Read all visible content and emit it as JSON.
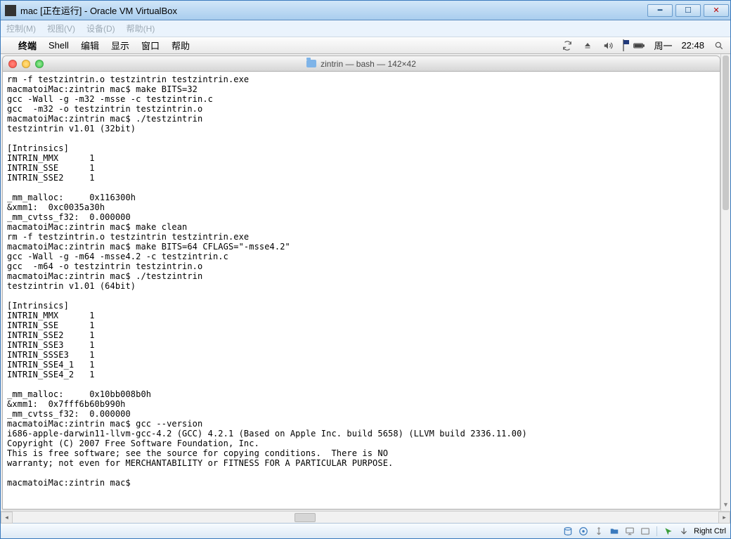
{
  "vbox": {
    "title": "mac [正在运行] - Oracle VM VirtualBox",
    "menu": [
      "控制(M)",
      "视图(V)",
      "设备(D)",
      "帮助(H)"
    ],
    "status_hostkey": "Right Ctrl"
  },
  "mac_menubar": {
    "left": [
      "终端",
      "Shell",
      "编辑",
      "显示",
      "窗口",
      "帮助"
    ],
    "right_day": "周一",
    "right_time": "22:48"
  },
  "terminal": {
    "title": "zintrin — bash — 142×42",
    "lines": [
      "rm -f testzintrin.o testzintrin testzintrin.exe",
      "macmatoiMac:zintrin mac$ make BITS=32",
      "gcc -Wall -g -m32 -msse -c testzintrin.c",
      "gcc  -m32 -o testzintrin testzintrin.o",
      "macmatoiMac:zintrin mac$ ./testzintrin",
      "testzintrin v1.01 (32bit)",
      "",
      "[Intrinsics]",
      "INTRIN_MMX      1",
      "INTRIN_SSE      1",
      "INTRIN_SSE2     1",
      "",
      "_mm_malloc:     0x116300h",
      "&xmm1:  0xc0035a30h",
      "_mm_cvtss_f32:  0.000000",
      "macmatoiMac:zintrin mac$ make clean",
      "rm -f testzintrin.o testzintrin testzintrin.exe",
      "macmatoiMac:zintrin mac$ make BITS=64 CFLAGS=\"-msse4.2\"",
      "gcc -Wall -g -m64 -msse4.2 -c testzintrin.c",
      "gcc  -m64 -o testzintrin testzintrin.o",
      "macmatoiMac:zintrin mac$ ./testzintrin",
      "testzintrin v1.01 (64bit)",
      "",
      "[Intrinsics]",
      "INTRIN_MMX      1",
      "INTRIN_SSE      1",
      "INTRIN_SSE2     1",
      "INTRIN_SSE3     1",
      "INTRIN_SSSE3    1",
      "INTRIN_SSE4_1   1",
      "INTRIN_SSE4_2   1",
      "",
      "_mm_malloc:     0x10bb008b0h",
      "&xmm1:  0x7fff6b60b990h",
      "_mm_cvtss_f32:  0.000000",
      "macmatoiMac:zintrin mac$ gcc --version",
      "i686-apple-darwin11-llvm-gcc-4.2 (GCC) 4.2.1 (Based on Apple Inc. build 5658) (LLVM build 2336.11.00)",
      "Copyright (C) 2007 Free Software Foundation, Inc.",
      "This is free software; see the source for copying conditions.  There is NO",
      "warranty; not even for MERCHANTABILITY or FITNESS FOR A PARTICULAR PURPOSE.",
      "",
      "macmatoiMac:zintrin mac$ "
    ]
  }
}
